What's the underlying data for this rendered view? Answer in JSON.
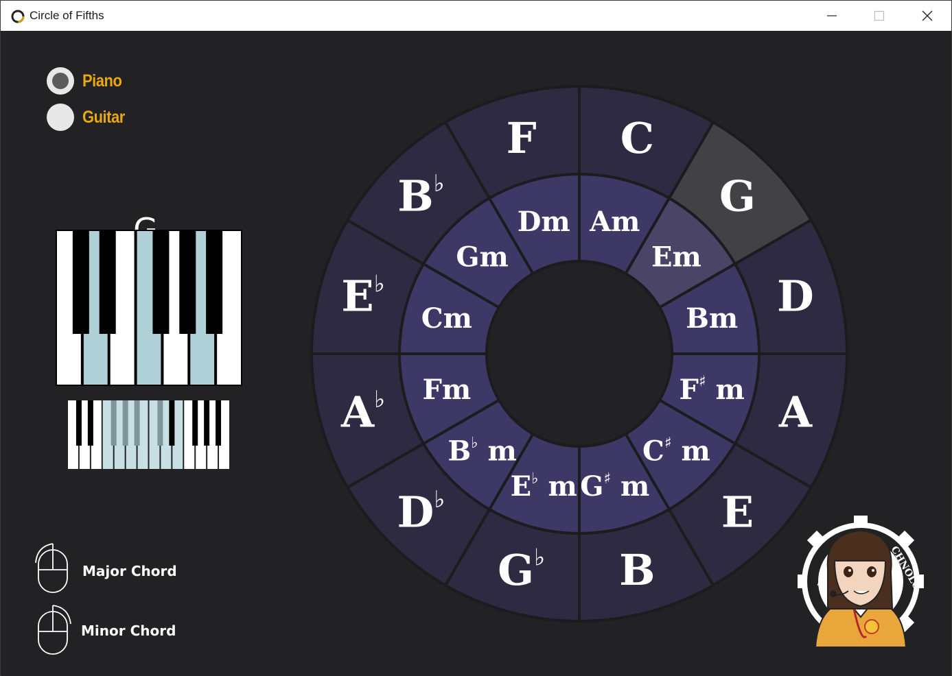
{
  "window": {
    "title": "Circle of Fifths"
  },
  "instrument": {
    "options": [
      {
        "label": "Piano",
        "checked": true
      },
      {
        "label": "Guitar",
        "checked": false
      }
    ]
  },
  "current_chord": "G",
  "legend": {
    "major_label": "Major Chord",
    "minor_label": "Minor Chord"
  },
  "circle": {
    "major_keys": [
      {
        "root": "C",
        "acc": ""
      },
      {
        "root": "G",
        "acc": ""
      },
      {
        "root": "D",
        "acc": ""
      },
      {
        "root": "A",
        "acc": ""
      },
      {
        "root": "E",
        "acc": ""
      },
      {
        "root": "B",
        "acc": ""
      },
      {
        "root": "G",
        "acc": "♭"
      },
      {
        "root": "D",
        "acc": "♭"
      },
      {
        "root": "A",
        "acc": "♭"
      },
      {
        "root": "E",
        "acc": "♭"
      },
      {
        "root": "B",
        "acc": "♭"
      },
      {
        "root": "F",
        "acc": ""
      }
    ],
    "minor_keys": [
      {
        "root": "A",
        "acc": "",
        "suffix": "m"
      },
      {
        "root": "E",
        "acc": "",
        "suffix": "m"
      },
      {
        "root": "B",
        "acc": "",
        "suffix": "m"
      },
      {
        "root": "F",
        "acc": "♯",
        "suffix": "m"
      },
      {
        "root": "C",
        "acc": "♯",
        "suffix": "m"
      },
      {
        "root": "G",
        "acc": "♯",
        "suffix": "m"
      },
      {
        "root": "E",
        "acc": "♭",
        "suffix": "m"
      },
      {
        "root": "B",
        "acc": "♭",
        "suffix": "m"
      },
      {
        "root": "F",
        "acc": "",
        "suffix": "m"
      },
      {
        "root": "C",
        "acc": "",
        "suffix": "m"
      },
      {
        "root": "G",
        "acc": "",
        "suffix": "m"
      },
      {
        "root": "D",
        "acc": "",
        "suffix": "m"
      }
    ],
    "selected_index": 1,
    "colors": {
      "outer": "#2d2a42",
      "inner": "#3d3866",
      "selected_outer": "#424246",
      "selected_inner": "#4a4566",
      "border": "#1c1c1f",
      "center": "#222224",
      "text": "#ffffff"
    }
  },
  "piano": {
    "highlight_color": "#aed0d6",
    "large_white_highlight": [
      1,
      3,
      5
    ],
    "mini_white_highlight": [
      3,
      4,
      5,
      6,
      7,
      8,
      9
    ],
    "mini_black_highlight": [
      2,
      3,
      4,
      5
    ]
  },
  "colors": {
    "accent": "#e8a80e",
    "window_bg": "#222224"
  },
  "icons": [
    "app-icon",
    "minimize-icon",
    "maximize-icon",
    "close-icon",
    "mouse-left-click-icon",
    "mouse-right-click-icon",
    "mascot-logo"
  ]
}
